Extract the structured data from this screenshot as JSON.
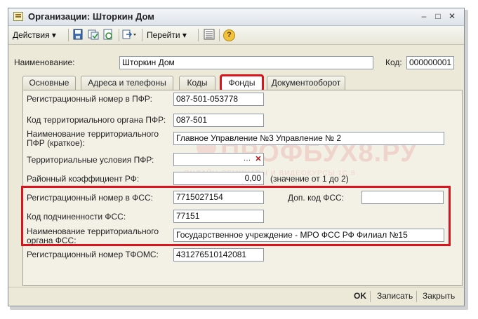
{
  "window": {
    "title": "Организации: Шторкин Дом",
    "minimize": "–",
    "maximize": "□",
    "close": "✕"
  },
  "toolbar": {
    "actions_label": "Действия ▾",
    "goto_label": "Перейти ▾",
    "help_label": "?"
  },
  "header": {
    "name_label": "Наименование:",
    "name_value": "Шторкин Дом",
    "code_label": "Код:",
    "code_value": "000000001"
  },
  "tabs": [
    {
      "label": "Основные"
    },
    {
      "label": "Адреса и телефоны"
    },
    {
      "label": "Коды"
    },
    {
      "label": "Фонды"
    },
    {
      "label": "Документооборот"
    }
  ],
  "form": {
    "pfr_reg_label": "Регистрационный номер в ПФР:",
    "pfr_reg_value": "087-501-053778",
    "pfr_code_label": "Код территориального органа ПФР:",
    "pfr_code_value": "087-501",
    "pfr_name_label_1": "Наименование территориального",
    "pfr_name_label_2": "ПФР (краткое):",
    "pfr_name_value": "Главное Управление №3 Управление № 2",
    "terr_cond_label": "Территориальные условия ПФР:",
    "terr_cond_value": "",
    "coef_label": "Районный коэффициент РФ:",
    "coef_value": "0,00",
    "coef_hint": "(значение от 1 до 2)",
    "fss_reg_label": "Регистрационный номер в  ФСС:",
    "fss_reg_value": "7715027154",
    "fss_extra_label": "Доп. код ФСС:",
    "fss_extra_value": "",
    "fss_sub_label": "Код подчиненности ФСС:",
    "fss_sub_value": "77151",
    "fss_name_label_1": "Наименование территориального",
    "fss_name_label_2": "органа ФСС:",
    "fss_name_value": "Государственное учреждение - МРО ФСС РФ Филиал №15",
    "tfoms_label": "Регистрационный номер ТФОМС:",
    "tfoms_value": "431276510142081"
  },
  "watermark": {
    "brand": "ПРОФБУХ8.РУ",
    "subtitle": "ОНЛАЙН-СЕМИНАРЫ И ВИДЕОКУРСЫ 1С:8"
  },
  "footer": {
    "ok_label": "OK",
    "save_label": "Записать",
    "close_label": "Закрыть"
  },
  "colors": {
    "highlight": "#d9141c",
    "window_bg": "#ece9d8"
  }
}
